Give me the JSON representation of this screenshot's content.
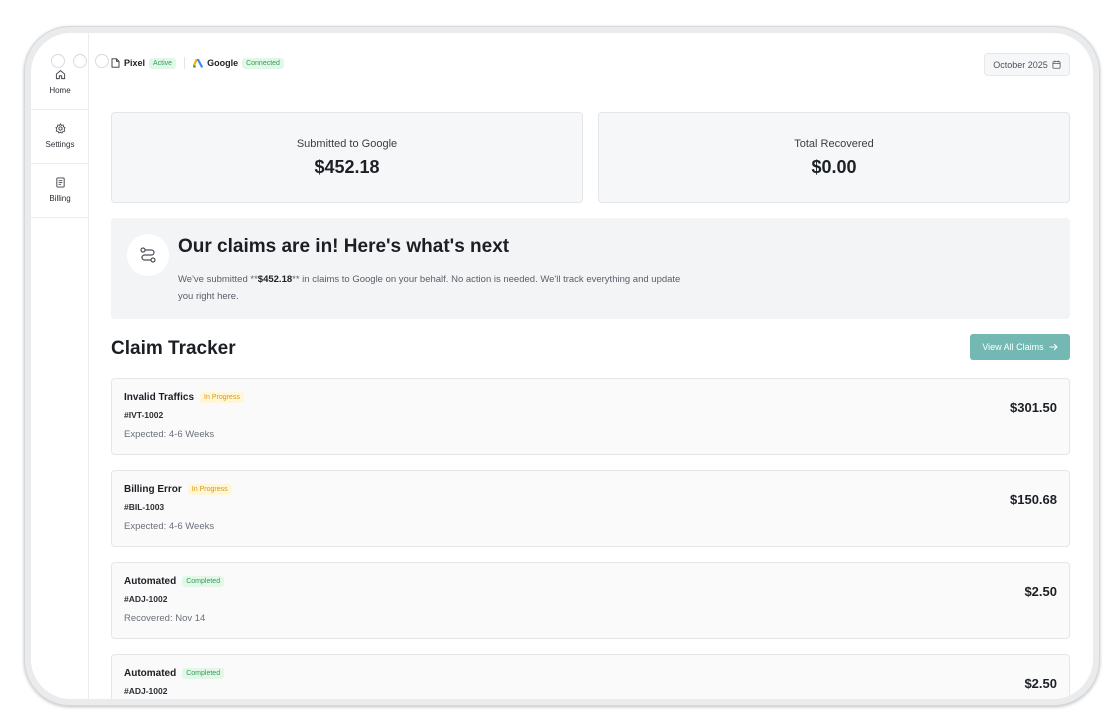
{
  "sidebar": {
    "items": [
      {
        "label": "Home",
        "icon": "home-icon"
      },
      {
        "label": "Settings",
        "icon": "gear-icon"
      },
      {
        "label": "Billing",
        "icon": "document-icon"
      }
    ]
  },
  "header": {
    "pixel": {
      "label": "Pixel",
      "status": "Active"
    },
    "google": {
      "label": "Google",
      "status": "Connected"
    },
    "month": "October 2025"
  },
  "stats": {
    "submitted": {
      "label": "Submitted to Google",
      "value": "$452.18"
    },
    "recovered": {
      "label": "Total Recovered",
      "value": "$0.00"
    }
  },
  "notice": {
    "title": "Our claims are in! Here's what's next",
    "body_prefix": "We've submitted **",
    "body_amount": "$452.18",
    "body_suffix": "** in claims to Google on your behalf. No action is needed. We'll track everything and update you right here."
  },
  "tracker": {
    "title": "Claim Tracker",
    "view_all_label": "View All Claims",
    "claims": [
      {
        "title": "Invalid Traffics",
        "status": "In Progress",
        "id": "#IVT-1002",
        "note": "Expected: 4-6 Weeks",
        "amount": "$301.50"
      },
      {
        "title": "Billing Error",
        "status": "In Progress",
        "id": "#BIL-1003",
        "note": "Expected: 4-6 Weeks",
        "amount": "$150.68"
      },
      {
        "title": "Automated",
        "status": "Completed",
        "id": "#ADJ-1002",
        "note": "Recovered: Nov 14",
        "amount": "$2.50"
      },
      {
        "title": "Automated",
        "status": "Completed",
        "id": "#ADJ-1002",
        "note": "",
        "amount": "$2.50"
      }
    ]
  },
  "colors": {
    "accent": "#73b8b2",
    "success_bg": "#e3f7e9",
    "success_text": "#2f9e58",
    "warning_bg": "#fff6d8",
    "warning_text": "#d69a12"
  }
}
